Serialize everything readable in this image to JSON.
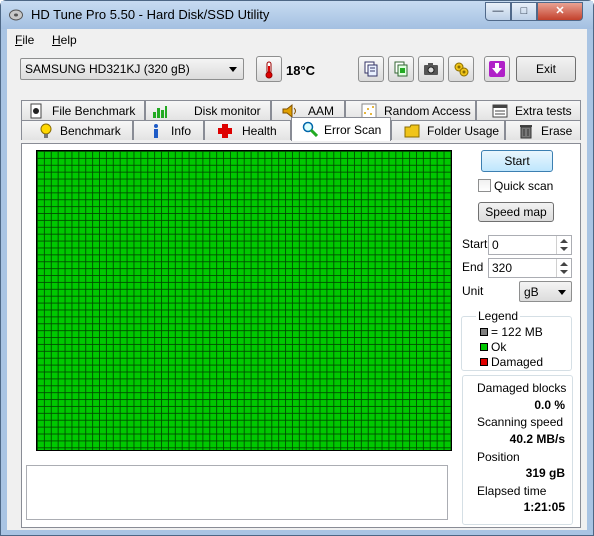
{
  "window": {
    "title": "HD Tune Pro 5.50 - Hard Disk/SSD Utility",
    "controls": {
      "minimize": "—",
      "maximize": "□",
      "close": "✕"
    }
  },
  "menu": {
    "file": {
      "accel": "F",
      "rest": "ile"
    },
    "help": {
      "accel": "H",
      "rest": "elp"
    }
  },
  "toolbar": {
    "drive": "SAMSUNG HD321KJ (320 gB)",
    "temperature": "18°C",
    "icons": [
      "thermometer-icon",
      "copy-text-icon",
      "copy-info-icon",
      "screenshot-icon",
      "options-icon",
      "save-icon"
    ],
    "exit_label": "Exit"
  },
  "tabs": {
    "row1": [
      {
        "label": "File Benchmark",
        "icon": "file-benchmark-icon"
      },
      {
        "label": "Disk monitor",
        "icon": "disk-monitor-icon"
      },
      {
        "label": "AAM",
        "icon": "speaker-icon"
      },
      {
        "label": "Random Access",
        "icon": "random-access-icon"
      },
      {
        "label": "Extra tests",
        "icon": "extra-tests-icon"
      }
    ],
    "row2": [
      {
        "label": "Benchmark",
        "icon": "lightbulb-icon"
      },
      {
        "label": "Info",
        "icon": "info-icon"
      },
      {
        "label": "Health",
        "icon": "health-icon"
      },
      {
        "label": "Error Scan",
        "icon": "magnifier-icon",
        "active": true
      },
      {
        "label": "Folder Usage",
        "icon": "folder-icon"
      },
      {
        "label": "Erase",
        "icon": "trash-icon"
      }
    ]
  },
  "scan": {
    "block_state": "Ok",
    "start_label": "Start",
    "quick_scan_label": "Quick scan",
    "quick_scan_checked": false,
    "speed_map_label": "Speed map",
    "start_field_label": "Start",
    "start_value": "0",
    "end_field_label": "End",
    "end_value": "320",
    "unit_label": "Unit",
    "unit_value": "gB",
    "log_text": ""
  },
  "legend": {
    "title": "Legend",
    "items": [
      {
        "label": "= 122 MB",
        "color": "#808080"
      },
      {
        "label": "Ok",
        "color": "#00c800"
      },
      {
        "label": "Damaged",
        "color": "#e00000"
      }
    ]
  },
  "stats": {
    "damaged_blocks_label": "Damaged blocks",
    "damaged_blocks_value": "0.0 %",
    "scanning_speed_label": "Scanning speed",
    "scanning_speed_value": "40.2 MB/s",
    "position_label": "Position",
    "position_value": "319 gB",
    "elapsed_time_label": "Elapsed time",
    "elapsed_time_value": "1:21:05"
  }
}
